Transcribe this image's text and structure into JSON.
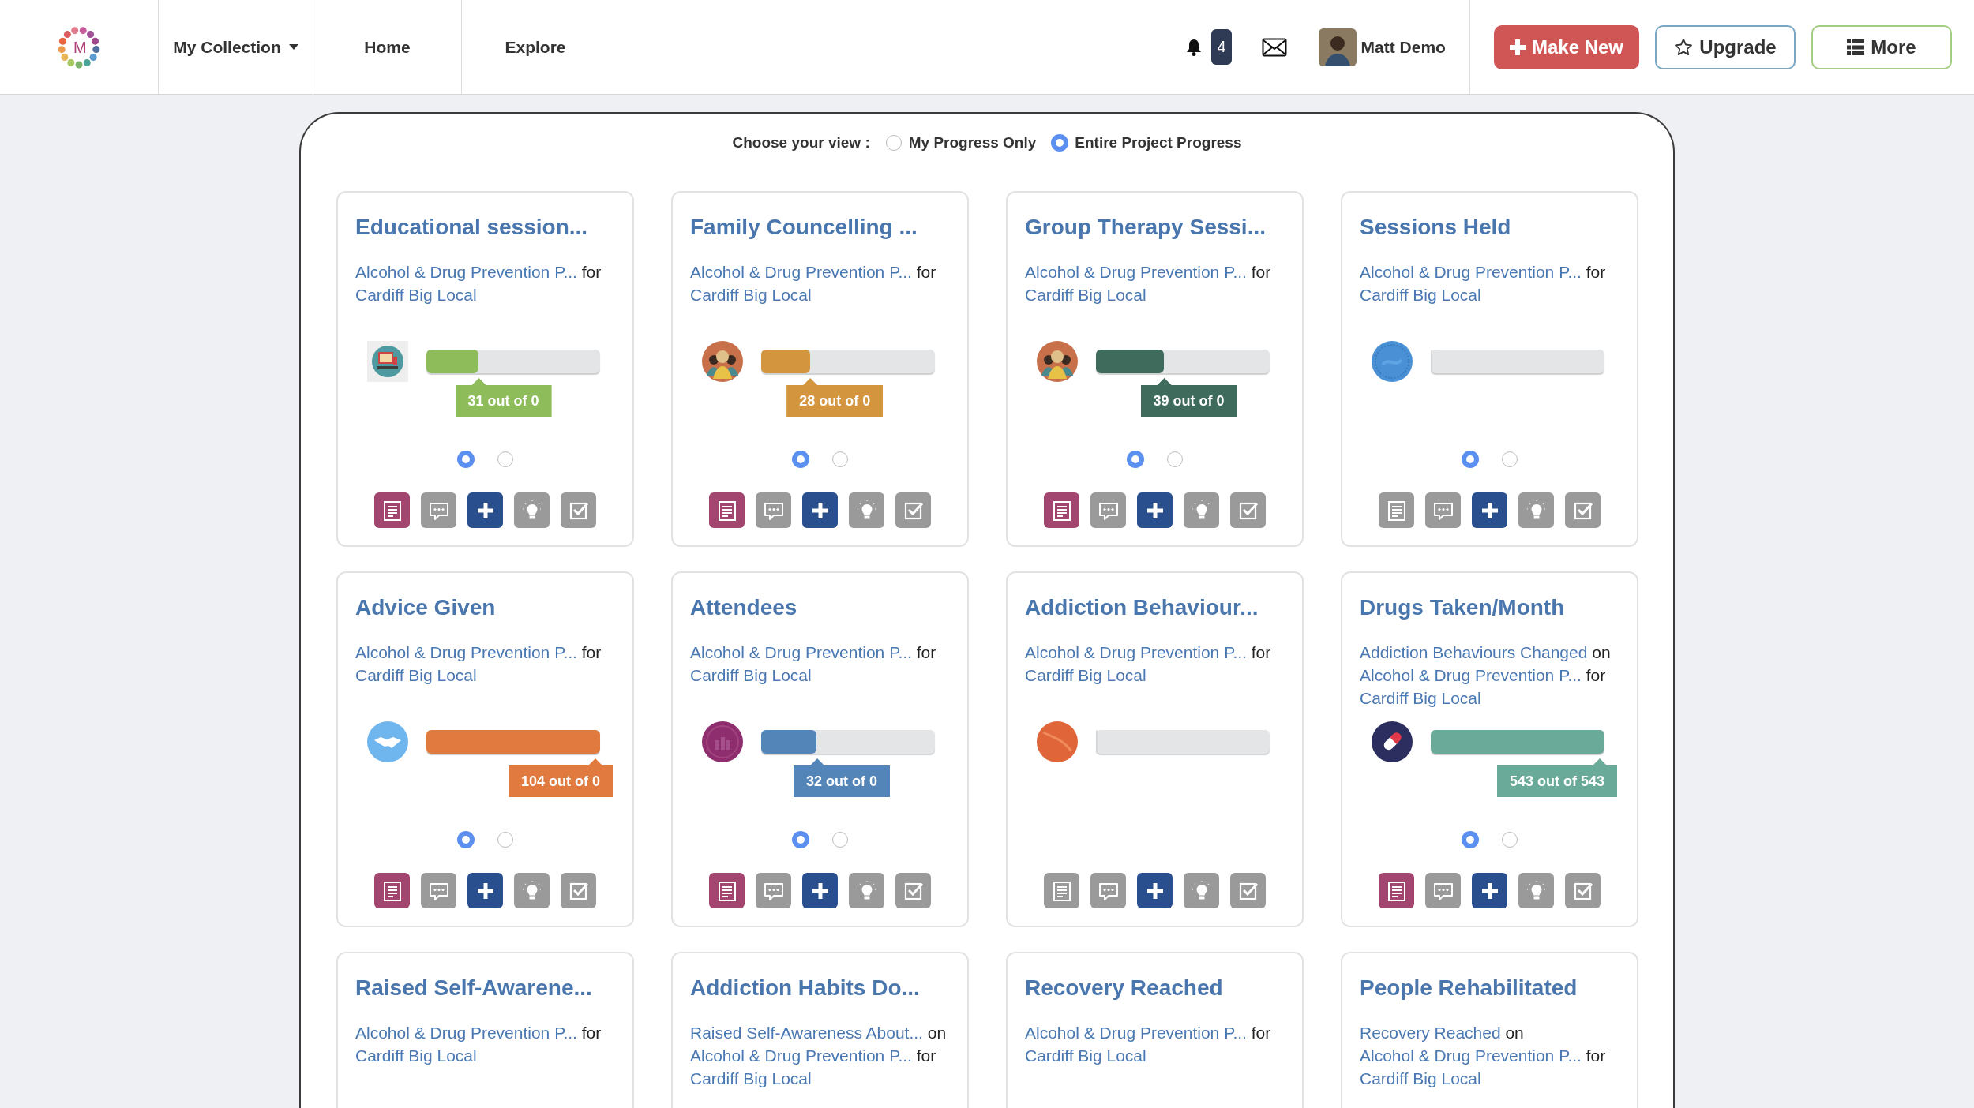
{
  "header": {
    "logo_letter": "M",
    "nav": [
      {
        "label": "My Collection",
        "dropdown": true
      },
      {
        "label": "Home",
        "dropdown": false
      },
      {
        "label": "Explore",
        "dropdown": false
      }
    ],
    "notification_count": "4",
    "user_name": "Matt Demo",
    "buttons": [
      {
        "kind": "make",
        "label": "Make New"
      },
      {
        "kind": "upgrade",
        "label": "Upgrade"
      },
      {
        "kind": "more",
        "label": "More"
      }
    ]
  },
  "view": {
    "label": "Choose your view :",
    "options": [
      {
        "label": "My Progress Only",
        "selected": false
      },
      {
        "label": "Entire Project Progress",
        "selected": true
      }
    ]
  },
  "cards": [
    {
      "title": "Educational session...",
      "kind": "classroom",
      "subtitle": [
        {
          "text": "Alcohol & Drug Prevention P...",
          "link": true
        },
        {
          "text": "for",
          "link": false
        },
        {
          "text": "Cardiff Big Local",
          "link": true
        }
      ],
      "progress": {
        "level": 0.3,
        "color": "#8fbc5b",
        "label": "31 out of 0"
      },
      "pages": [
        {
          "selected": true
        },
        {
          "selected": false
        }
      ],
      "notes_active": true
    },
    {
      "title": "Family Councelling ...",
      "kind": "group",
      "subtitle": [
        {
          "text": "Alcohol & Drug Prevention P...",
          "link": true
        },
        {
          "text": "for",
          "link": false
        },
        {
          "text": "Cardiff Big Local",
          "link": true
        }
      ],
      "progress": {
        "level": 0.28,
        "color": "#d4953f",
        "label": "28 out of 0"
      },
      "pages": [
        {
          "selected": true
        },
        {
          "selected": false
        }
      ],
      "notes_active": true
    },
    {
      "title": "Group Therapy Sessi...",
      "kind": "group",
      "subtitle": [
        {
          "text": "Alcohol & Drug Prevention P...",
          "link": true
        },
        {
          "text": "for",
          "link": false
        },
        {
          "text": "Cardiff Big Local",
          "link": true
        }
      ],
      "progress": {
        "level": 0.39,
        "color": "#3f6b5c",
        "label": "39 out of 0"
      },
      "pages": [
        {
          "selected": true
        },
        {
          "selected": false
        }
      ],
      "notes_active": true
    },
    {
      "title": "Sessions Held",
      "kind": "globe",
      "subtitle": [
        {
          "text": "Alcohol & Drug Prevention P...",
          "link": true
        },
        {
          "text": "for",
          "link": false
        },
        {
          "text": "Cardiff Big Local",
          "link": true
        }
      ],
      "progress": {
        "level": 0
      },
      "pages": [
        {
          "selected": true
        },
        {
          "selected": false
        }
      ],
      "notes_active": false
    },
    {
      "title": "Advice Given",
      "kind": "handshake",
      "subtitle": [
        {
          "text": "Alcohol & Drug Prevention P...",
          "link": true
        },
        {
          "text": "for",
          "link": false
        },
        {
          "text": "Cardiff Big Local",
          "link": true
        }
      ],
      "progress": {
        "level": 1,
        "color": "#e07a3e",
        "label": "104 out of 0"
      },
      "pages": [
        {
          "selected": true
        },
        {
          "selected": false
        }
      ],
      "notes_active": true
    },
    {
      "title": "Attendees",
      "kind": "people",
      "subtitle": [
        {
          "text": "Alcohol & Drug Prevention P...",
          "link": true
        },
        {
          "text": "for",
          "link": false
        },
        {
          "text": "Cardiff Big Local",
          "link": true
        }
      ],
      "progress": {
        "level": 0.32,
        "color": "#5485b8",
        "label": "32 out of 0"
      },
      "pages": [
        {
          "selected": true
        },
        {
          "selected": false
        }
      ],
      "notes_active": true
    },
    {
      "title": "Addiction Behaviour...",
      "kind": "ball",
      "subtitle": [
        {
          "text": "Alcohol & Drug Prevention P...",
          "link": true
        },
        {
          "text": "for",
          "link": false
        },
        {
          "text": "Cardiff Big Local",
          "link": true
        }
      ],
      "progress": {
        "level": 0
      },
      "notes_active": false
    },
    {
      "title": "Drugs Taken/Month",
      "kind": "pills",
      "subtitle": [
        {
          "text": "Addiction Behaviours Changed",
          "link": true
        },
        {
          "text": "on",
          "link": false
        },
        {
          "text": "Alcohol & Drug Prevention P...",
          "link": true
        },
        {
          "text": "for",
          "link": false
        },
        {
          "text": "Cardiff Big Local",
          "link": true
        }
      ],
      "progress": {
        "level": 1,
        "color": "#6aaa98",
        "label": "543 out of 543"
      },
      "pages": [
        {
          "selected": true
        },
        {
          "selected": false
        }
      ],
      "notes_active": true
    },
    {
      "title": "Raised Self-Awarene...",
      "subtitle": [
        {
          "text": "Alcohol & Drug Prevention P...",
          "link": true
        },
        {
          "text": "for",
          "link": false
        },
        {
          "text": "Cardiff Big Local",
          "link": true
        }
      ]
    },
    {
      "title": "Addiction Habits Do...",
      "subtitle": [
        {
          "text": "Raised Self-Awareness About...",
          "link": true
        },
        {
          "text": "on",
          "link": false
        },
        {
          "text": "Alcohol & Drug Prevention P...",
          "link": true
        },
        {
          "text": "for",
          "link": false
        },
        {
          "text": "Cardiff Big Local",
          "link": true
        }
      ]
    },
    {
      "title": "Recovery Reached",
      "subtitle": [
        {
          "text": "Alcohol & Drug Prevention P...",
          "link": true
        },
        {
          "text": "for",
          "link": false
        },
        {
          "text": "Cardiff Big Local",
          "link": true
        }
      ]
    },
    {
      "title": "People Rehabilitated",
      "subtitle": [
        {
          "text": "Recovery Reached",
          "link": true
        },
        {
          "text": "on",
          "link": false
        },
        {
          "text": "Alcohol & Drug Prevention P...",
          "link": true
        },
        {
          "text": "for",
          "link": false
        },
        {
          "text": "Cardiff Big Local",
          "link": true
        }
      ]
    }
  ]
}
